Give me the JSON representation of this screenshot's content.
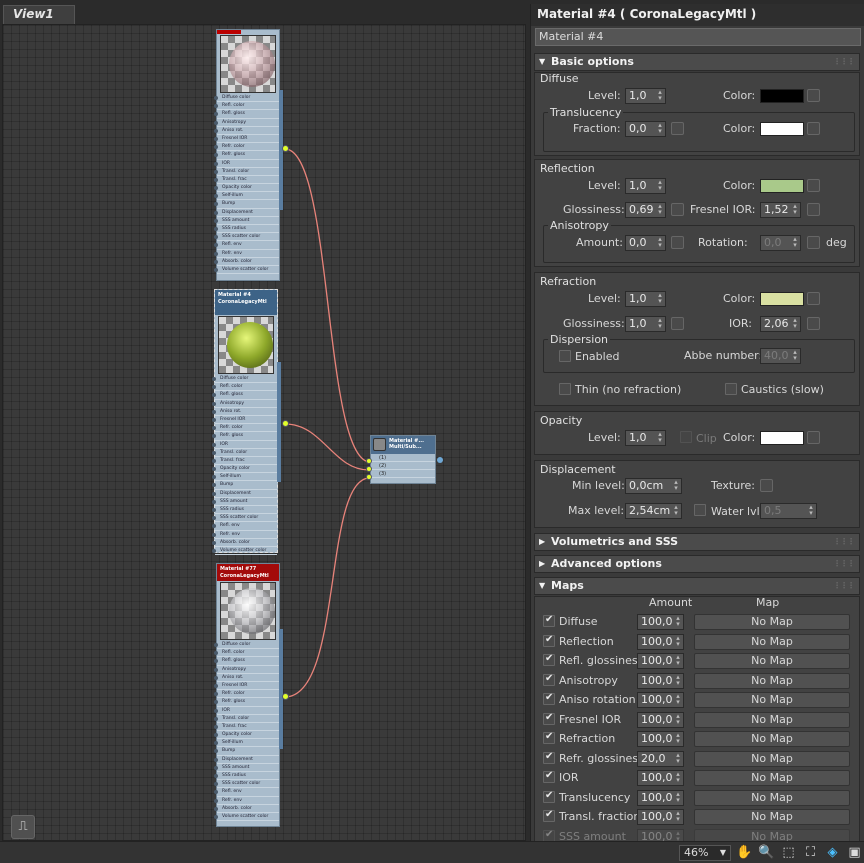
{
  "view": {
    "tab_label": "View1"
  },
  "nodes": {
    "top": {
      "title": "",
      "subtitle": ""
    },
    "middle": {
      "title": "Material #4",
      "subtitle": "CoronaLegacyMtl"
    },
    "bottom": {
      "title": "Material #77",
      "subtitle": "CoronaLegacyMtl"
    },
    "slots": [
      "Diffuse color",
      "Refl. color",
      "Refl. gloss",
      "Anisotropy",
      "Aniso rot.",
      "Fresnel IOR",
      "Refr. color",
      "Refr. gloss",
      "IOR",
      "Transl. color",
      "Transl. frac",
      "Opacity color",
      "Self-illum",
      "Bump",
      "Displacement",
      "SSS amount",
      "SSS radius",
      "SSS scatter color",
      "Refl. env",
      "Refr. env",
      "Absorb. color",
      "Volume scatter color"
    ],
    "multi": {
      "title": "Material #...",
      "subtitle": "Multi/Sub...",
      "slots": [
        "(1)",
        "(2)",
        "(3)"
      ]
    }
  },
  "panel": {
    "title": "Material #4  ( CoronaLegacyMtl )",
    "name_field": "Material #4",
    "basic_options": {
      "header": "Basic options",
      "diffuse": {
        "section": "Diffuse",
        "level_label": "Level:",
        "level": "1,0",
        "color_label": "Color:",
        "color": "#000000"
      },
      "translucency": {
        "section": "Translucency",
        "fraction_label": "Fraction:",
        "fraction": "0,0",
        "color_label": "Color:",
        "color": "#ffffff"
      },
      "reflection": {
        "section": "Reflection",
        "level_label": "Level:",
        "level": "1,0",
        "color_label": "Color:",
        "color": "#a9c98a",
        "gloss_label": "Glossiness:",
        "gloss": "0,69",
        "fresnel_label": "Fresnel IOR:",
        "fresnel": "1,52"
      },
      "anisotropy": {
        "section": "Anisotropy",
        "amount_label": "Amount:",
        "amount": "0,0",
        "rotation_label": "Rotation:",
        "rotation": "0,0",
        "deg": "deg"
      },
      "refraction": {
        "section": "Refraction",
        "level_label": "Level:",
        "level": "1,0",
        "color_label": "Color:",
        "color": "#d9e0a2",
        "gloss_label": "Glossiness:",
        "gloss": "1,0",
        "ior_label": "IOR:",
        "ior": "2,06"
      },
      "dispersion": {
        "section": "Dispersion",
        "enabled_label": "Enabled",
        "abbe_label": "Abbe number:",
        "abbe": "40,0"
      },
      "thin_label": "Thin (no refraction)",
      "caustics_label": "Caustics (slow)",
      "opacity": {
        "section": "Opacity",
        "level_label": "Level:",
        "level": "1,0",
        "clip_label": "Clip",
        "color_label": "Color:",
        "color": "#ffffff"
      },
      "displacement": {
        "section": "Displacement",
        "min_label": "Min level:",
        "min": "0,0cm",
        "texture_label": "Texture:",
        "max_label": "Max level:",
        "max": "2,54cm",
        "water_label": "Water lvl.",
        "water": "0,5"
      }
    },
    "volumetrics": {
      "header": "Volumetrics and SSS"
    },
    "advanced": {
      "header": "Advanced options"
    },
    "maps": {
      "header": "Maps",
      "amount_header": "Amount",
      "map_header": "Map",
      "rows": [
        {
          "name": "Diffuse",
          "amount": "100,0",
          "map": "No Map"
        },
        {
          "name": "Reflection",
          "amount": "100,0",
          "map": "No Map"
        },
        {
          "name": "Refl. glossiness",
          "amount": "100,0",
          "map": "No Map"
        },
        {
          "name": "Anisotropy",
          "amount": "100,0",
          "map": "No Map"
        },
        {
          "name": "Aniso rotation",
          "amount": "100,0",
          "map": "No Map"
        },
        {
          "name": "Fresnel IOR",
          "amount": "100,0",
          "map": "No Map"
        },
        {
          "name": "Refraction",
          "amount": "100,0",
          "map": "No Map"
        },
        {
          "name": "Refr. glossiness",
          "amount": "20,0",
          "map": "No Map"
        },
        {
          "name": "IOR",
          "amount": "100,0",
          "map": "No Map"
        },
        {
          "name": "Translucency",
          "amount": "100,0",
          "map": "No Map"
        },
        {
          "name": "Transl. fraction",
          "amount": "100,0",
          "map": "No Map"
        },
        {
          "name": "SSS amount",
          "amount": "100,0",
          "map": "No Map"
        }
      ]
    }
  },
  "statusbar": {
    "zoom": "46%"
  }
}
